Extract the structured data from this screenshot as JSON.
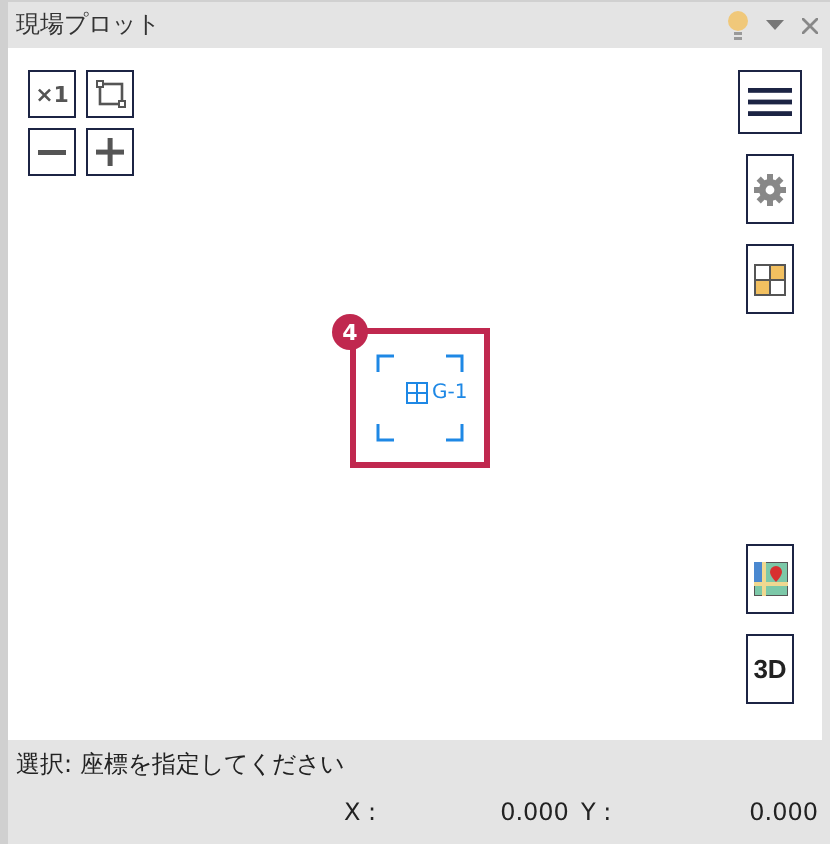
{
  "window": {
    "title": "現場プロット"
  },
  "zoom_tools": {
    "actual_size": "×1"
  },
  "right_tools": {
    "view_3d": "3D"
  },
  "marker": {
    "badge": "4",
    "label": "G-1"
  },
  "status_bar": {
    "message": "選択: 座標を指定してください",
    "x_label": "X :",
    "x_value": "0.000",
    "y_label": "Y :",
    "y_value": "0.000"
  }
}
